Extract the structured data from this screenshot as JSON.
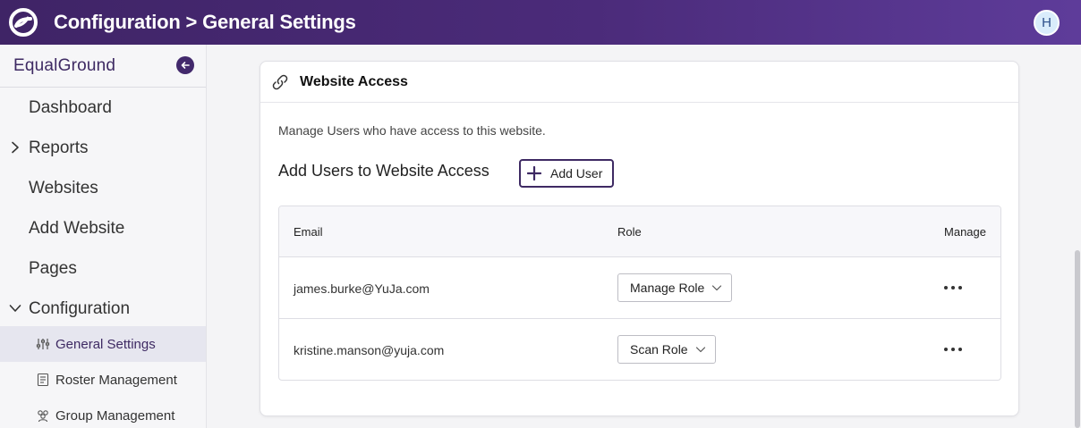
{
  "header": {
    "title": "Configuration > General Settings",
    "avatar_initial": "H",
    "colors": {
      "brand_gradient_start": "#3f2466",
      "brand_gradient_end": "#5e3c9a"
    }
  },
  "sidebar": {
    "org_name": "EqualGround",
    "collapse_icon": "arrow-left-circle-icon",
    "items": [
      {
        "label": "Dashboard"
      },
      {
        "label": "Reports",
        "icon": "chevron-right-icon"
      },
      {
        "label": "Websites"
      },
      {
        "label": "Add Website"
      },
      {
        "label": "Pages"
      },
      {
        "label": "Configuration",
        "icon": "chevron-down-icon"
      }
    ],
    "sub_items": [
      {
        "label": "General Settings",
        "icon": "sliders-icon",
        "active": true
      },
      {
        "label": "Roster Management",
        "icon": "list-document-icon"
      },
      {
        "label": "Group Management",
        "icon": "group-icon"
      }
    ]
  },
  "card": {
    "title": "Website Access",
    "icon": "link-icon",
    "description": "Manage Users who have access to this website.",
    "section_title": "Add Users to Website Access",
    "add_user_label": "Add User",
    "table": {
      "columns": [
        "Email",
        "Role",
        "Manage"
      ],
      "rows": [
        {
          "email": "james.burke@YuJa.com",
          "role": "Manage Role"
        },
        {
          "email": "kristine.manson@yuja.com",
          "role": "Scan Role"
        }
      ]
    }
  }
}
